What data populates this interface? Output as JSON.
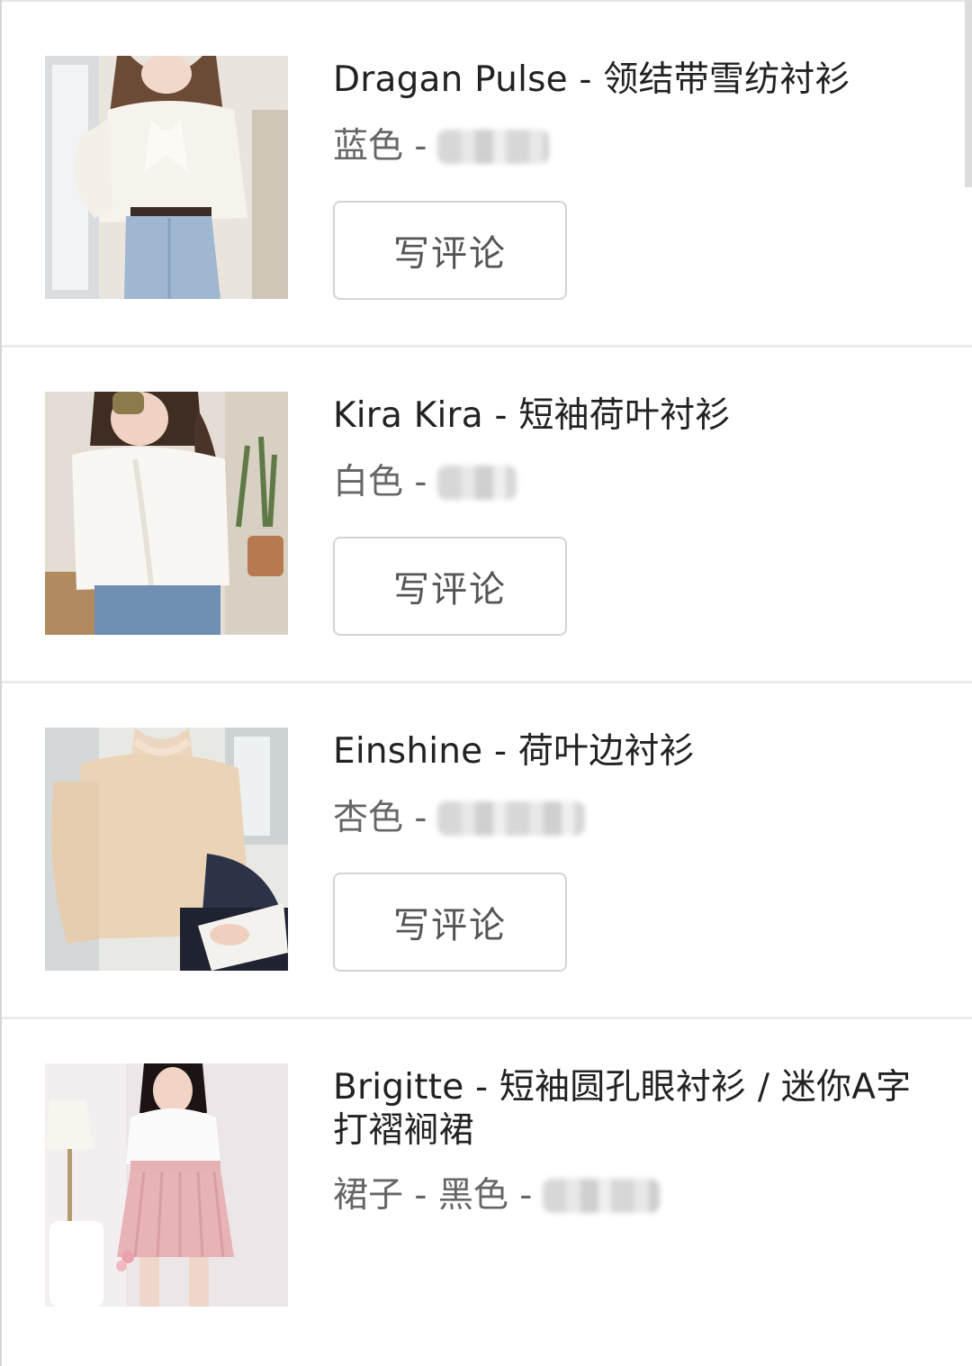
{
  "orders": [
    {
      "title": "Dragan Pulse - 领结带雪纺衬衫",
      "variant": "蓝色 -",
      "review_button": "写评论"
    },
    {
      "title": "Kira Kira - 短袖荷叶衬衫",
      "variant": "白色 -",
      "review_button": "写评论"
    },
    {
      "title": "Einshine - 荷叶边衬衫",
      "variant": "杏色 -",
      "review_button": "写评论"
    },
    {
      "title": "Brigitte - 短袖圆孔眼衬衫 / 迷你A字打褶裥裙",
      "variant": "裙子 - 黑色 -"
    }
  ]
}
